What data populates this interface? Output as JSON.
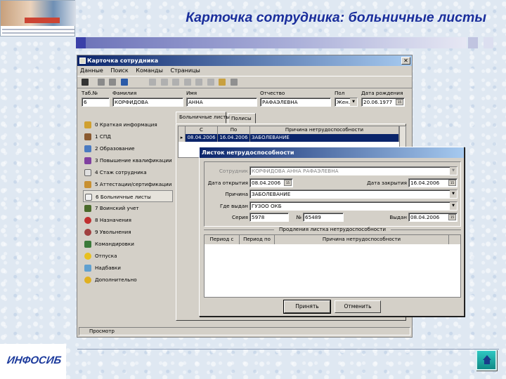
{
  "slide": {
    "title": "Карточка сотрудника: больничные листы",
    "footer_logo": "ИНФОСИБ",
    "colors": {
      "title": "#1a2e9c",
      "accent": "#3a40a8",
      "win_title": "#0a246a"
    }
  },
  "window": {
    "title": "Карточка сотрудника",
    "menu": [
      "Данные",
      "Поиск",
      "Команды",
      "Страницы"
    ],
    "fields": {
      "tab_label": "Таб.№",
      "tab_value": "6",
      "lastname_label": "Фамилия",
      "lastname_value": "КОРФИДОВА",
      "firstname_label": "Имя",
      "firstname_value": "АННА",
      "patronymic_label": "Отчество",
      "patronymic_value": "РАФАЭЛЕВНА",
      "gender_label": "Пол",
      "gender_value": "Жен.",
      "birth_label": "Дата рождения",
      "birth_value": "20.06.1977"
    },
    "nav": [
      "0 Краткая информация",
      "1 СПД",
      "2 Образование",
      "3 Повышение квалификации",
      "4 Стаж сотрудника",
      "5 Аттестации/сертификации",
      "6 Больничные листы",
      "7 Воинский учет",
      "8 Назначения",
      "9 Увольнения",
      "Командировки",
      "Отпуска",
      "Надбавки",
      "Дополнительно"
    ],
    "tabs": [
      "Больничные листы",
      "Полисы"
    ],
    "grid": {
      "columns": [
        "С",
        "По",
        "Причина нетрудоспособности"
      ],
      "rows": [
        [
          "08.04.2006",
          "16.04.2006",
          "ЗАБОЛЕВАНИЕ"
        ]
      ]
    },
    "status": "Просмотр"
  },
  "dialog": {
    "title": "Листок нетрудоспособности",
    "employee_label": "Сотрудник",
    "employee_value": "КОРФИДОВА АННА РАФАЭЛЕВНА",
    "open_label": "Дата открытия",
    "open_value": "08.04.2006",
    "close_label": "Дата закрытия",
    "close_value": "16.04.2006",
    "reason_label": "Причина",
    "reason_value": "ЗАБОЛЕВАНИЕ",
    "issued_label": "Где выдан",
    "issued_value": "ГУЗОО ОКБ",
    "series_label": "Серия",
    "series_value": "5978",
    "number_label": "№",
    "number_value": "65489",
    "issued_date_label": "Выдан",
    "issued_date_value": "08.04.2006",
    "ext_header": "Продления листка нетрудоспособности",
    "ext_columns": [
      "Период с",
      "Период по",
      "Причина нетрудоспособности"
    ],
    "ok": "Принять",
    "cancel": "Отменить"
  }
}
